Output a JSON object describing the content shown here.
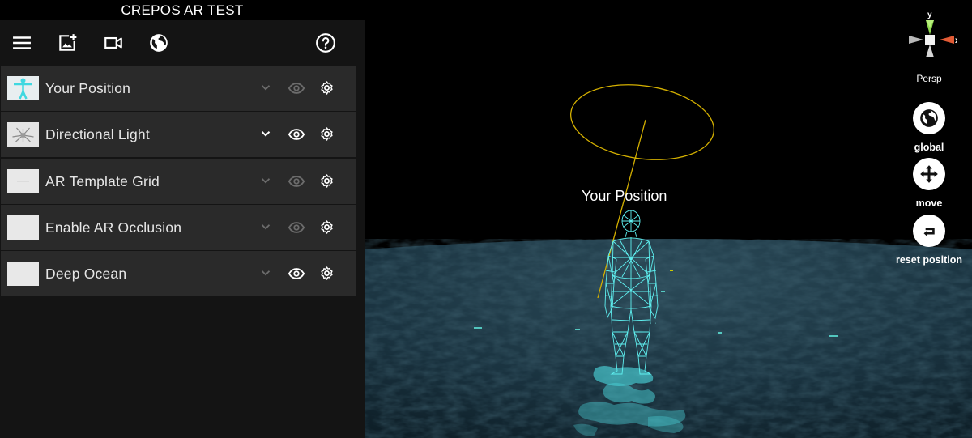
{
  "app_title": "CREPOS AR TEST",
  "toolbar": {
    "menu_icon": "hamburger-menu-icon",
    "add_image_icon": "add-image-icon",
    "video_icon": "video-camera-icon",
    "globe_icon": "globe-icon",
    "help_icon": "help-circle-icon"
  },
  "layers": [
    {
      "name": "Your Position",
      "thumbnail": "person-figure",
      "visible": false
    },
    {
      "name": "Directional Light",
      "thumbnail": "light-rays",
      "visible": true
    },
    {
      "name": "AR Template Grid",
      "thumbnail": "grid",
      "visible": false
    },
    {
      "name": "Enable AR Occlusion",
      "thumbnail": "blank",
      "visible": false
    },
    {
      "name": "Deep Ocean",
      "thumbnail": "blank",
      "visible": true
    }
  ],
  "viewport": {
    "object_label": "Your Position",
    "camera_mode": "Persp",
    "axis_labels": {
      "y": "y",
      "x": "x"
    },
    "ground_color": "#16313f",
    "wireframe_color": "#5ff0f0",
    "ring_color": "#d4b000"
  },
  "controls": {
    "global_label": "global",
    "move_label": "move",
    "reset_label": "reset position"
  }
}
